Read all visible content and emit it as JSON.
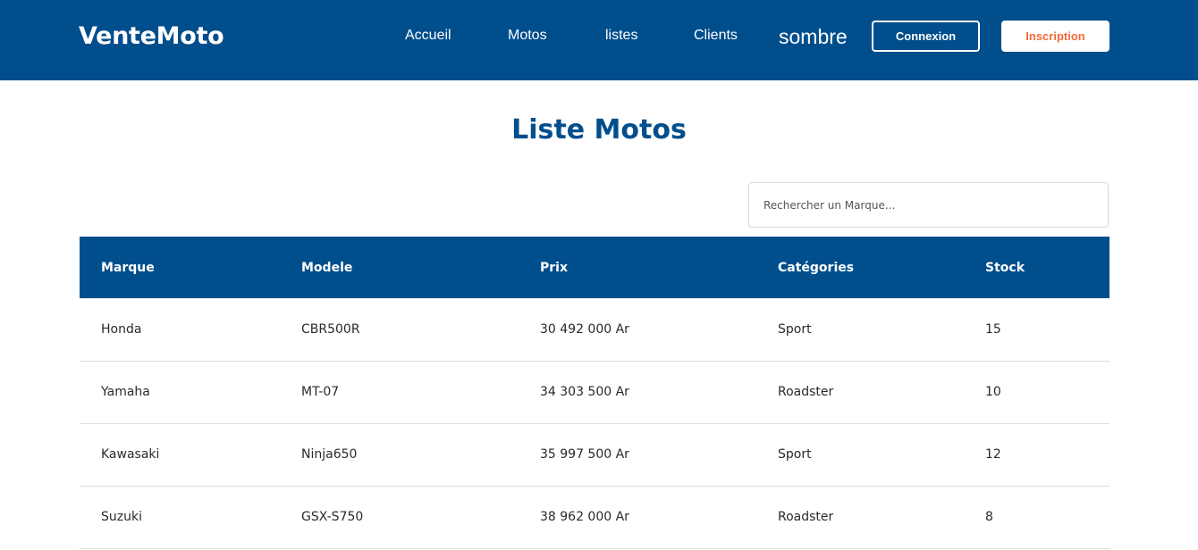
{
  "header": {
    "brand": "VenteMoto",
    "nav": [
      "Accueil",
      "Motos",
      "listes",
      "Clients"
    ],
    "theme_toggle": "sombre",
    "login_label": "Connexion",
    "signup_label": "Inscription"
  },
  "main": {
    "title": "Liste Motos",
    "search_placeholder": "Rechercher un Marque...",
    "table": {
      "columns": [
        "Marque",
        "Modele",
        "Prix",
        "Catégories",
        "Stock"
      ],
      "rows": [
        [
          "Honda",
          "CBR500R",
          "30 492 000 Ar",
          "Sport",
          "15"
        ],
        [
          "Yamaha",
          "MT-07",
          "34 303 500 Ar",
          "Roadster",
          "10"
        ],
        [
          "Kawasaki",
          "Ninja650",
          "35 997 500 Ar",
          "Sport",
          "12"
        ],
        [
          "Suzuki",
          "GSX-S750",
          "38 962 000 Ar",
          "Roadster",
          "8"
        ]
      ]
    }
  },
  "colors": {
    "primary": "#004e8c",
    "accent": "#f26b3a",
    "background": "#ffffff"
  }
}
